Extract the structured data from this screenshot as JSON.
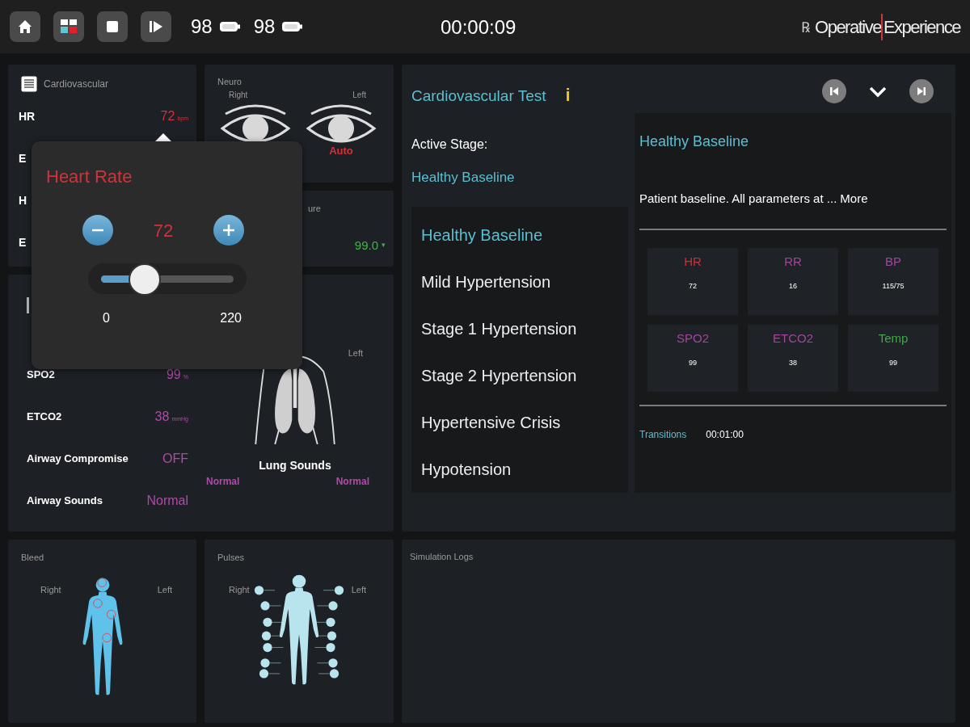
{
  "toolbar": {
    "buttons": [
      {
        "kind": "home"
      },
      {
        "kind": "layout"
      },
      {
        "kind": "stop"
      },
      {
        "kind": "step"
      }
    ],
    "batteries": [
      {
        "reading": "98"
      },
      {
        "reading": "98"
      }
    ],
    "timer": "00:00:09",
    "logo": {
      "symbol": "℞",
      "words": [
        "Operative",
        "Experience"
      ]
    }
  },
  "cardiovascular": {
    "title": "Cardiovascular",
    "rows": [
      {
        "label": "HR",
        "value": "72",
        "unit": "bpm",
        "color": "#d2323a"
      },
      {
        "label": "E"
      },
      {
        "label": "H"
      },
      {
        "label": "E"
      }
    ]
  },
  "neuro": {
    "title": "Neuro",
    "right": "Right",
    "left": "Left",
    "left_pupil": "Auto"
  },
  "temperature": {
    "title": "ure",
    "value": "99.0",
    "trend": "▾"
  },
  "respiratory": {
    "rows": [
      {
        "label": "SPO2",
        "value": "99",
        "unit": "%",
        "color": "#b04aa8"
      },
      {
        "label": "ETCO2",
        "value": "38",
        "unit": "mmHg",
        "color": "#b04aa8"
      },
      {
        "label": "Airway Compromise",
        "value": "OFF",
        "color": "#b04aa8"
      },
      {
        "label": "Airway Sounds",
        "value": "Normal",
        "color": "#b04aa8"
      }
    ],
    "side_label": "Left",
    "lung_title": "Lung Sounds",
    "right_sound": "Normal",
    "left_sound": "Normal"
  },
  "bleed": {
    "title": "Bleed",
    "right": "Right",
    "left": "Left"
  },
  "pulses": {
    "title": "Pulses",
    "right": "Right",
    "left": "Left"
  },
  "scenario": {
    "title": "Cardiovascular Test",
    "info": "i",
    "active_label": "Active Stage:",
    "active_stage": "Healthy Baseline",
    "stages": [
      {
        "name": "Healthy Baseline",
        "selected": true
      },
      {
        "name": "Mild Hypertension",
        "selected": false
      },
      {
        "name": "Stage 1 Hypertension",
        "selected": false
      },
      {
        "name": "Stage 2 Hypertension",
        "selected": false
      },
      {
        "name": "Hypertensive Crisis",
        "selected": false
      },
      {
        "name": "Hypotension",
        "selected": false
      }
    ],
    "detail": {
      "title": "Healthy Baseline",
      "description": "Patient baseline. All parameters at ...",
      "more": "More",
      "vitals": [
        {
          "label": "HR",
          "value": "72",
          "color": "#c8323a"
        },
        {
          "label": "RR",
          "value": "16",
          "color": "#a0479a"
        },
        {
          "label": "BP",
          "value": "115/75",
          "color": "#a0479a"
        },
        {
          "label": "SPO2",
          "value": "99",
          "color": "#a0479a"
        },
        {
          "label": "ETCO2",
          "value": "38",
          "color": "#a0479a"
        },
        {
          "label": "Temp",
          "value": "99",
          "color": "#3fa84a"
        }
      ],
      "transitions_label": "Transitions",
      "transitions_time": "00:01:00"
    }
  },
  "logs": {
    "title": "Simulation Logs"
  },
  "heart_rate_popup": {
    "title": "Heart Rate",
    "value": "72",
    "level": 0.327,
    "min": "0",
    "max": "220"
  }
}
